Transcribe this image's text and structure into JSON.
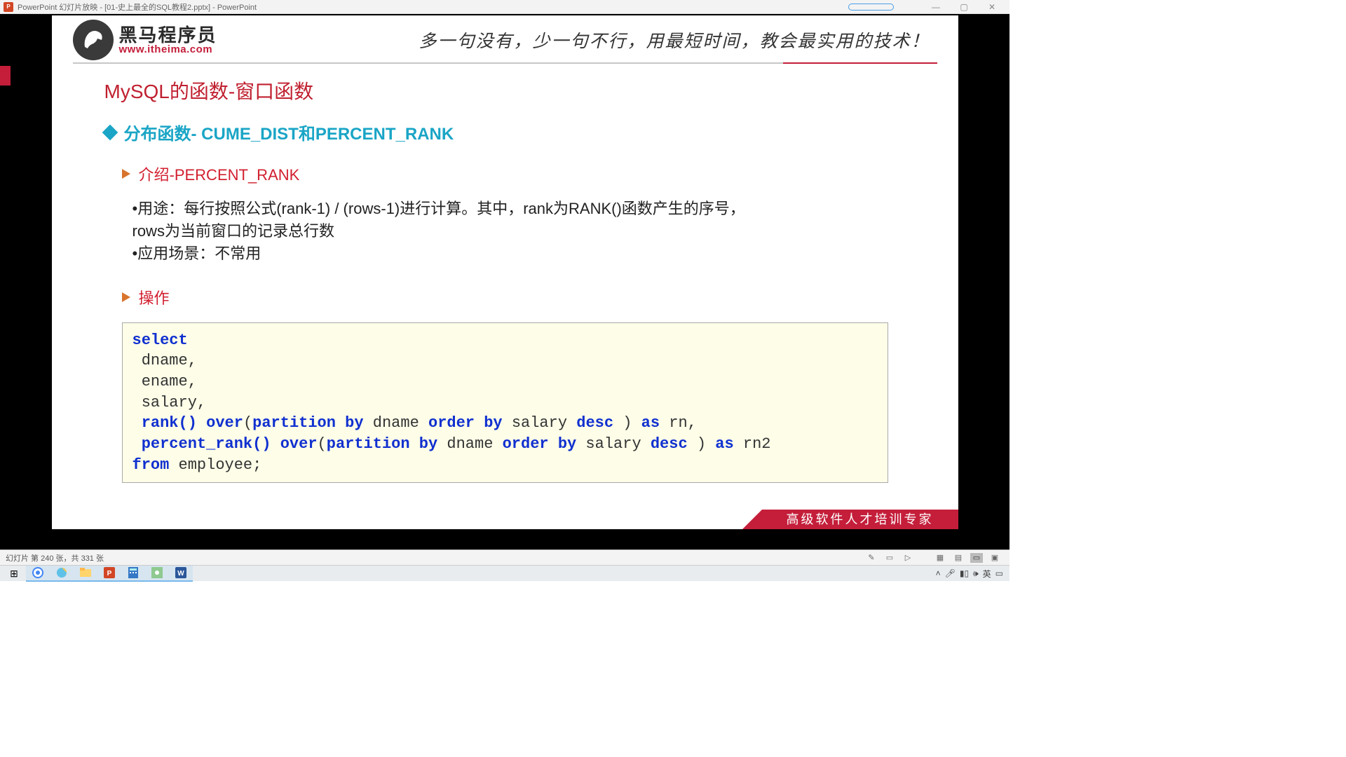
{
  "titlebar": {
    "app_icon_text": "P",
    "title": "PowerPoint 幻灯片放映 - [01-史上最全的SQL教程2.pptx] - PowerPoint",
    "min": "—",
    "max": "▢",
    "close": "✕"
  },
  "slide": {
    "logo_cn": "黑马程序员",
    "logo_url": "www.itheima.com",
    "slogan": "多一句没有，少一句不行，用最短时间，教会最实用的技术！",
    "title": "MySQL的函数-窗口函数",
    "h2": "分布函数- CUME_DIST和PERCENT_RANK",
    "h3_intro": "介绍-PERCENT_RANK",
    "desc_line1": "•用途：每行按照公式(rank-1) / (rows-1)进行计算。其中，rank为RANK()函数产生的序号，rows为当前窗口的记录总行数",
    "desc_line2": "•应用场景：不常用",
    "h3_op": "操作",
    "code": {
      "l1_kw": "select",
      "l2": " dname,",
      "l3": " ename,",
      "l4": " salary,",
      "l5a": " rank() over",
      "l5b": "(",
      "l5c": "partition by",
      "l5d": " dname ",
      "l5e": "order by",
      "l5f": " salary ",
      "l5g": "desc",
      "l5h": " ) ",
      "l5i": "as",
      "l5j": " rn,",
      "l6a": " percent_rank() over",
      "l6b": "(",
      "l6c": "partition by",
      "l6d": " dname ",
      "l6e": "order by",
      "l6f": " salary ",
      "l6g": "desc",
      "l6h": " ) ",
      "l6i": "as",
      "l6j": " rn2",
      "l7a": "from",
      "l7b": " employee;"
    },
    "footer": "高级软件人才培训专家"
  },
  "statusbar": {
    "slide_info": "幻灯片 第 240 张，共 331 张"
  },
  "taskbar": {
    "start": "⊞"
  }
}
